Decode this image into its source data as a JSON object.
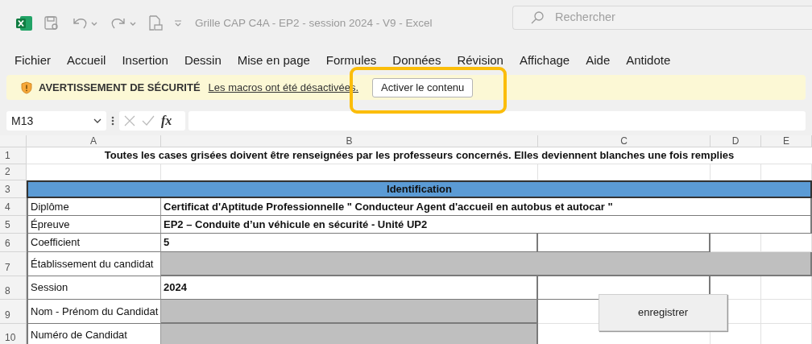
{
  "window": {
    "title": "Grille CAP C4A - EP2 - session 2024 - V9  -  Excel",
    "search_placeholder": "Rechercher"
  },
  "menu_tabs": [
    "Fichier",
    "Accueil",
    "Insertion",
    "Dessin",
    "Mise en page",
    "Formules",
    "Données",
    "Révision",
    "Affichage",
    "Aide",
    "Antidote"
  ],
  "security_bar": {
    "title": "AVERTISSEMENT DE SÉCURITÉ",
    "message": "Les macros ont été désactivées.",
    "button": {
      "label": "Activer le contenu",
      "highlighted": true
    }
  },
  "formula_bar": {
    "name_box": "M13",
    "fx": "fx"
  },
  "sheet": {
    "columns": [
      "A",
      "B",
      "C",
      "D",
      "E"
    ],
    "rows": [
      {
        "number": "1",
        "cells": [
          {
            "kind": "title",
            "text": "Toutes les cases grisées doivent être renseignées par les professeurs concernés. Elles deviennent blanches une fois remplies"
          }
        ]
      },
      {
        "number": "2",
        "cells": [
          {
            "kind": "plain"
          },
          {
            "kind": "plain"
          },
          {
            "kind": "plain"
          },
          {
            "kind": "plain"
          },
          {
            "kind": "plain"
          }
        ]
      },
      {
        "number": "3",
        "cells": [
          {
            "kind": "header",
            "text": "Identification"
          }
        ]
      },
      {
        "number": "4",
        "cells": [
          {
            "kind": "label",
            "text": "Diplôme"
          },
          {
            "kind": "value",
            "text": "Certificat d'Aptitude Professionnelle \" Conducteur Agent d'accueil en autobus et autocar \""
          }
        ]
      },
      {
        "number": "5",
        "cells": [
          {
            "kind": "label",
            "text": "Épreuve"
          },
          {
            "kind": "value",
            "text": "EP2 – Conduite d’un véhicule en sécurité - Unité UP2"
          }
        ]
      },
      {
        "number": "6",
        "cells": [
          {
            "kind": "label",
            "text": "Coefficient"
          },
          {
            "kind": "value",
            "text": "5"
          },
          {
            "kind": "value"
          },
          {
            "kind": "plain"
          },
          {
            "kind": "plain"
          }
        ]
      },
      {
        "number": "7",
        "cells": [
          {
            "kind": "label",
            "text": "Établissement du candidat"
          },
          {
            "kind": "required"
          }
        ]
      },
      {
        "number": "8",
        "cells": [
          {
            "kind": "label",
            "text": "Session"
          },
          {
            "kind": "value",
            "text": "2024"
          },
          {
            "kind": "value"
          },
          {
            "kind": "plain"
          },
          {
            "kind": "plain"
          }
        ]
      },
      {
        "number": "9",
        "cells": [
          {
            "kind": "label",
            "text": "Nom - Prénom du Candidat"
          },
          {
            "kind": "required"
          },
          {
            "kind": "plain"
          },
          {
            "kind": "plain"
          },
          {
            "kind": "plain"
          }
        ]
      },
      {
        "number": "10",
        "cells": [
          {
            "kind": "label",
            "text": "Numéro de Candidat"
          },
          {
            "kind": "required"
          },
          {
            "kind": "plain"
          },
          {
            "kind": "plain"
          },
          {
            "kind": "plain"
          }
        ]
      }
    ],
    "form_button": "enregistrer"
  }
}
